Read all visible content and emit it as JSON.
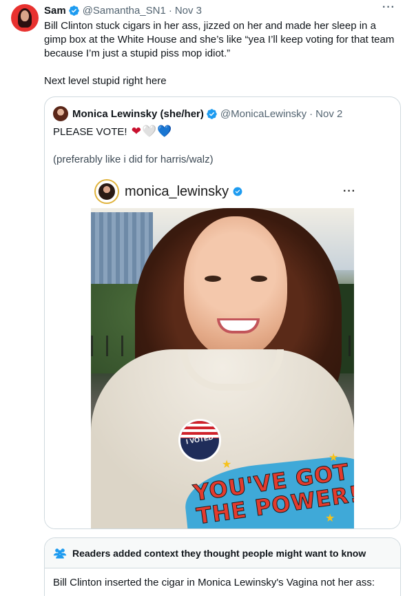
{
  "tweet": {
    "author_name": "Sam",
    "handle": "@Samantha_SN1",
    "separator": "·",
    "date": "Nov 3",
    "text_para1": "Bill Clinton stuck cigars in her ass, jizzed on her and made her sleep in a gimp box at the White House and she’s like “yea I’ll keep voting for that team because I’m just a stupid piss mop idiot.”",
    "text_para2": "Next level stupid right here",
    "more_icon": "more-horizontal-icon"
  },
  "quote": {
    "author_name": "Monica Lewinsky (she/her)",
    "handle": "@MonicaLewinsky",
    "separator": "·",
    "date": "Nov 2",
    "text_para1": "PLEASE VOTE!",
    "hearts": [
      "❤",
      "🤍",
      "💙"
    ],
    "text_para2": "(preferably like i did for harris/walz)",
    "media": {
      "ig_username": "monica_lewinsky",
      "ig_more": "···",
      "sticker_text": "I VOTED",
      "sweater_text": "YOU'VE GOT THE POWER!"
    }
  },
  "community_note": {
    "header": "Readers added context they thought people might want to know",
    "body": "Bill Clinton inserted the cigar in Monica Lewinsky's Vagina not her ass:"
  },
  "colors": {
    "verified_blue": "#1d9bf0",
    "text_primary": "#0f1419",
    "text_muted": "#536471",
    "border": "#cfd9de",
    "note_icon_blue": "#1d9bf0"
  }
}
